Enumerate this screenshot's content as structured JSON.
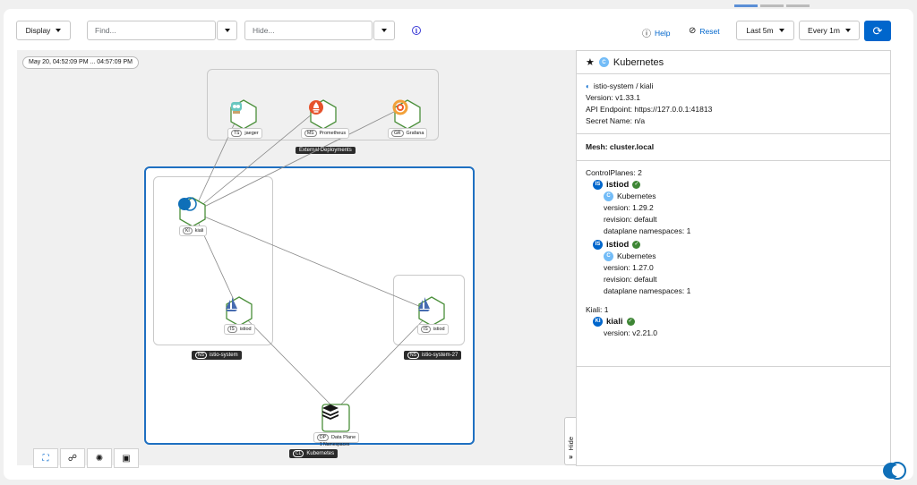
{
  "toolbar": {
    "display_label": "Display",
    "find_placeholder": "Find...",
    "hide_placeholder": "Hide...",
    "help_label": "Help",
    "reset_label": "Reset",
    "duration_label": "Last 5m",
    "refresh_interval_label": "Every 1m"
  },
  "graph": {
    "time_range": "May 20, 04:52:09 PM ... 04:57:09 PM",
    "boxes": {
      "external": "External Deployments",
      "istio_system": "istio-system",
      "istio_system_27": "istio-system-27",
      "kubernetes": "Kubernetes"
    },
    "nodes": {
      "jaeger": {
        "badge": "TS",
        "label": "jaeger"
      },
      "prometheus": {
        "badge": "MS",
        "label": "Prometheus"
      },
      "grafana": {
        "badge": "GR",
        "label": "Grafana"
      },
      "kiali": {
        "badge": "KI",
        "label": "kiali"
      },
      "istiod1": {
        "badge": "IS",
        "label": "istiod"
      },
      "istiod2": {
        "badge": "IS",
        "label": "istiod"
      },
      "dataplane": {
        "badge": "DP",
        "label": "Data Plane",
        "sub": "1 Namespaces"
      }
    },
    "box_badges": {
      "istio_system": "NS",
      "istio_system_27": "NS",
      "kubernetes": "CL"
    },
    "hide_label": "Hide"
  },
  "panel": {
    "title": "Kubernetes",
    "kiali_instance": "istio-system / kiali",
    "version": "Version: v1.33.1",
    "api_endpoint": "API Endpoint: https://127.0.0.1:41813",
    "secret_name": "Secret Name: n/a",
    "mesh": "Mesh: cluster.local",
    "control_planes_label": "ControlPlanes: 2",
    "control_planes": [
      {
        "name": "istiod",
        "cluster": "Kubernetes",
        "version": "version: 1.29.2",
        "revision": "revision: default",
        "namespaces": "dataplane namespaces: 1"
      },
      {
        "name": "istiod",
        "cluster": "Kubernetes",
        "version": "version: 1.27.0",
        "revision": "revision: default",
        "namespaces": "dataplane namespaces: 1"
      }
    ],
    "kiali_label": "Kiali: 1",
    "kiali": {
      "name": "kiali",
      "version": "version: v2.21.0"
    },
    "badges": {
      "cluster": "C",
      "istiod": "IS",
      "kiali": "KI"
    }
  },
  "colors": {
    "primary": "#0066cc",
    "cluster_box": "#1f70c1",
    "success": "#3e8635",
    "prometheus": "#e6522c"
  }
}
